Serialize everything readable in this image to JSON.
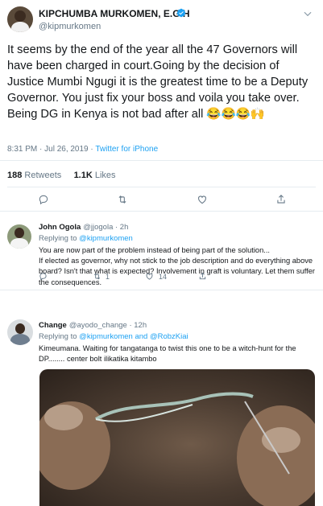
{
  "main_tweet": {
    "author_name": "KIPCHUMBA MURKOMEN, E.G.H",
    "handle": "@kipmurkomen",
    "text": "It seems by the end of the year all the 47 Governors will have been charged in court.Going by the decision of Justice Mumbi Ngugi it is the greatest time to be a Deputy Governor. You just fix your boss and voila you take over. Being DG in Kenya is not bad after all 😂😂😂🙌",
    "timestamp": "8:31 PM · Jul 26, 2019 · ",
    "source": "Twitter for iPhone",
    "retweets_count": "188",
    "retweets_label": "Retweets",
    "likes_count": "1.1K",
    "likes_label": "Likes",
    "colors": {
      "link": "#1da1f2",
      "muted": "#657786",
      "text": "#14171a"
    }
  },
  "replies": [
    {
      "name": "John Ogola",
      "handle_time": "@jjogola · 2h",
      "replying_label": "Replying to ",
      "replying_to": "@kipmurkomen",
      "text": "You are now part of the problem instead of being part of the solution...\nIf elected as governor, why not stick to the job description and do everything above board? Isn't that what is expected? Involvement in graft is voluntary. Let them suffer the consequences.",
      "retweets": "1",
      "likes": "14"
    },
    {
      "name": "Change",
      "handle_time": "@ayodo_change · 12h",
      "replying_label": "Replying to ",
      "replying_to": "@kipmurkomen and @RobzKiai",
      "text": "Kimeumana. Waiting for tangatanga to twist this one to be a witch-hunt for the DP........ center bolt ilikatika kitambo"
    }
  ],
  "icons": [
    "verified-badge-icon",
    "chevron-down-icon",
    "reply-icon",
    "retweet-icon",
    "like-icon",
    "share-icon"
  ]
}
